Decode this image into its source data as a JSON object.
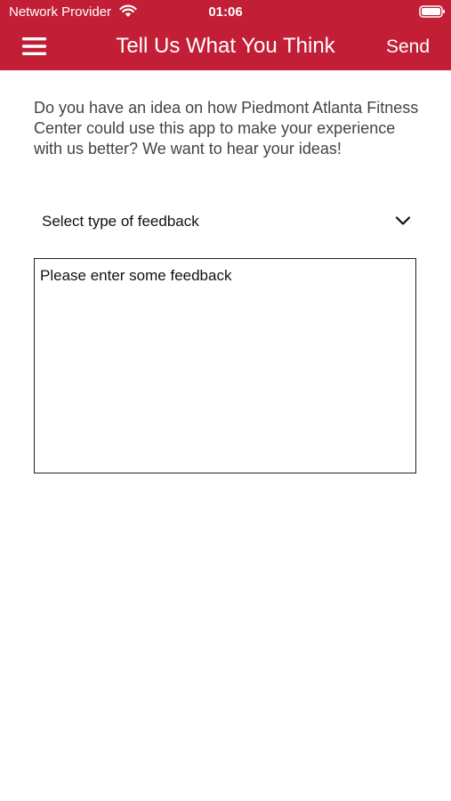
{
  "status_bar": {
    "carrier": "Network Provider",
    "time": "01:06",
    "wifi_icon": "wifi-icon",
    "battery_icon": "battery-icon"
  },
  "nav": {
    "menu_icon": "hamburger-menu-icon",
    "title": "Tell Us What You Think",
    "send_label": "Send"
  },
  "content": {
    "intro": "Do you have an idea on how Piedmont Atlanta Fitness Center could use this app to make your experience with us better? We want to hear your ideas!",
    "feedback_type": {
      "selected": "Select type of feedback",
      "icon": "chevron-down-icon"
    },
    "feedback_box": {
      "value": "",
      "placeholder": "Please enter some feedback"
    }
  },
  "colors": {
    "accent": "#c21f37",
    "on_accent": "#ffffff",
    "text": "#111111",
    "body_text": "#444444"
  }
}
